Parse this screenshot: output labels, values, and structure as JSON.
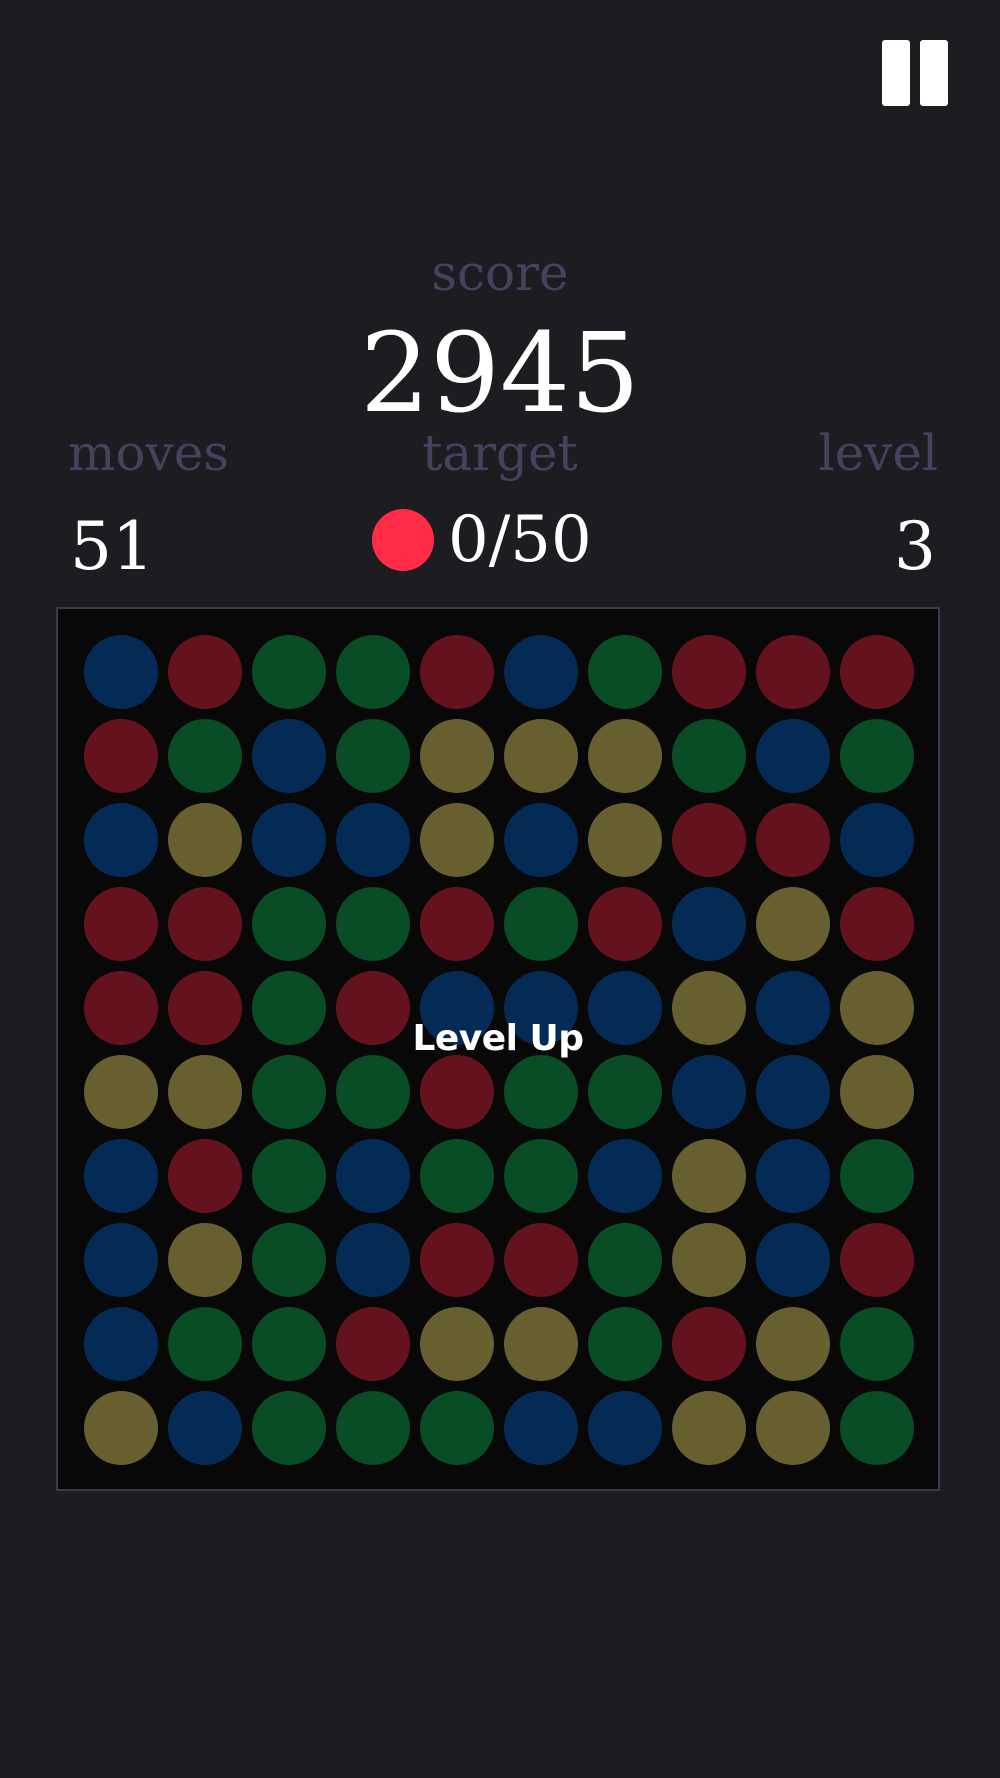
{
  "header": {
    "pause_icon": "pause-icon"
  },
  "stats": {
    "score_label": "score",
    "score_value": "2945",
    "moves_label": "moves",
    "moves_value": "51",
    "target_label": "target",
    "target_progress": "0/50",
    "target_color": "#ff2b47",
    "level_label": "level",
    "level_value": "3"
  },
  "board": {
    "overlay_text": "Level Up",
    "palette": {
      "blue": "#032b55",
      "red": "#64121d",
      "green": "#084d26",
      "yellow": "#675f30"
    },
    "grid": [
      [
        "blue",
        "red",
        "green",
        "green",
        "red",
        "blue",
        "green",
        "red",
        "red",
        "red"
      ],
      [
        "red",
        "green",
        "blue",
        "green",
        "yellow",
        "yellow",
        "yellow",
        "green",
        "blue",
        "green"
      ],
      [
        "blue",
        "yellow",
        "blue",
        "blue",
        "yellow",
        "blue",
        "yellow",
        "red",
        "red",
        "blue"
      ],
      [
        "red",
        "red",
        "green",
        "green",
        "red",
        "green",
        "red",
        "blue",
        "yellow",
        "red"
      ],
      [
        "red",
        "red",
        "green",
        "red",
        "blue",
        "blue",
        "blue",
        "yellow",
        "blue",
        "yellow"
      ],
      [
        "yellow",
        "yellow",
        "green",
        "green",
        "red",
        "green",
        "green",
        "blue",
        "blue",
        "yellow"
      ],
      [
        "blue",
        "red",
        "green",
        "blue",
        "green",
        "green",
        "blue",
        "yellow",
        "blue",
        "green"
      ],
      [
        "blue",
        "yellow",
        "green",
        "blue",
        "red",
        "red",
        "green",
        "yellow",
        "blue",
        "red"
      ],
      [
        "blue",
        "green",
        "green",
        "red",
        "yellow",
        "yellow",
        "green",
        "red",
        "yellow",
        "green"
      ],
      [
        "yellow",
        "blue",
        "green",
        "green",
        "green",
        "blue",
        "blue",
        "yellow",
        "yellow",
        "green"
      ]
    ]
  }
}
